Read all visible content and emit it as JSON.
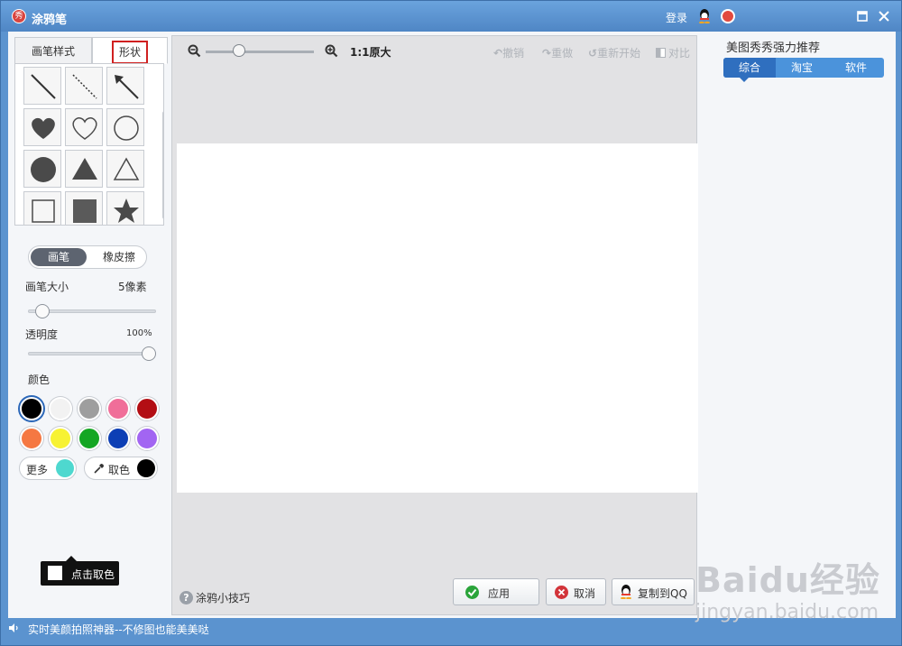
{
  "window": {
    "title": "涂鸦笔",
    "login_label": "登录",
    "logo_text": "秀"
  },
  "left": {
    "tabs": [
      {
        "label": "画笔样式"
      },
      {
        "label": "形状"
      }
    ],
    "shapes": [
      {
        "name": "line-icon"
      },
      {
        "name": "dashed-line-icon"
      },
      {
        "name": "arrow-icon"
      },
      {
        "name": "heart-filled-icon"
      },
      {
        "name": "heart-outline-icon"
      },
      {
        "name": "circle-outline-icon"
      },
      {
        "name": "circle-filled-icon"
      },
      {
        "name": "triangle-filled-icon"
      },
      {
        "name": "triangle-outline-icon"
      },
      {
        "name": "square-outline-icon"
      },
      {
        "name": "square-filled-icon"
      },
      {
        "name": "star-filled-icon"
      }
    ],
    "mode": {
      "brush": "画笔",
      "eraser": "橡皮擦"
    },
    "brush_size": {
      "label": "画笔大小",
      "value_text": "5像素",
      "fraction": 0.06
    },
    "opacity": {
      "label": "透明度",
      "value_text": "100%",
      "fraction": 1.0
    },
    "color_label": "颜色",
    "colors": [
      "#000000",
      "#f2f2f2",
      "#9e9e9e",
      "#f06e99",
      "#b30e14",
      "#f57842",
      "#f7f232",
      "#14a623",
      "#0d3fb5",
      "#a265f2"
    ],
    "more_label": "更多",
    "more_color": "#4ed8cf",
    "pick_label": "取色",
    "pick_color": "#000000",
    "tooltip": "点击取色"
  },
  "center": {
    "zoom_label": "1:1原大",
    "undo_label": "撤销",
    "redo_label": "重做",
    "restart_label": "重新开始",
    "compare_label": "对比",
    "tip_label": "涂鸦小技巧",
    "apply_label": "应用",
    "cancel_label": "取消",
    "copy_label": "复制到QQ"
  },
  "right": {
    "title": "美图秀秀强力推荐",
    "tabs": [
      {
        "label": "综合"
      },
      {
        "label": "淘宝"
      },
      {
        "label": "软件"
      }
    ]
  },
  "status": {
    "text": "实时美颜拍照神器--不修图也能美美哒"
  },
  "watermark": {
    "brand": "Baidu经验",
    "url": "jingyan.baidu.com"
  }
}
